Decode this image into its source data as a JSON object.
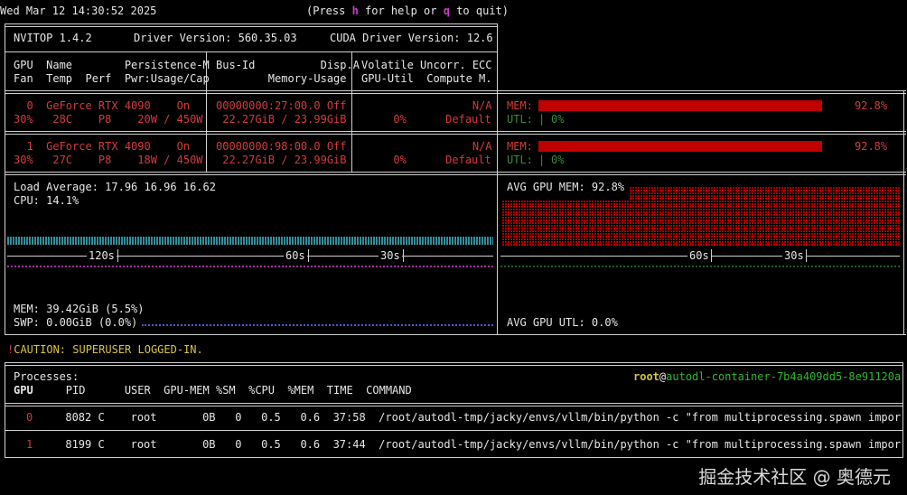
{
  "header": {
    "datetime": "Wed Mar 12 14:30:52 2025",
    "help_prefix": "(Press ",
    "help_key": "h",
    "help_mid": " for help or ",
    "quit_key": "q",
    "help_suffix": " to quit)"
  },
  "info": {
    "version": "NVITOP 1.4.2",
    "driver": "Driver Version: 560.35.03",
    "cuda": "CUDA Driver Version: 12.6"
  },
  "gpu_header": {
    "col1_line1": "GPU  Name        Persistence-M",
    "col1_line2": "Fan  Temp  Perf  Pwr:Usage/Cap",
    "col2_line1": "Bus-Id          Disp.A",
    "col2_line2": "        Memory-Usage",
    "col3_line1": "Volatile Uncorr. ECC",
    "col3_line2": "GPU-Util  Compute M."
  },
  "gpus": [
    {
      "line1_col1": "  0  GeForce RTX 4090    On",
      "line2_col1": "30%   28C    P8    20W / 450W",
      "line1_col2": "00000000:27:00.0 Off",
      "line2_col2": " 22.27GiB / 23.99GiB",
      "line1_col3": "                 N/A",
      "line2_col3": "      0%      Default",
      "mem_label": "MEM: ",
      "mem_pct": "92.8%",
      "mem_fraction": 0.928,
      "utl_label": "UTL: ",
      "utl_sep": "|",
      "utl_pct": "0%"
    },
    {
      "line1_col1": "  1  GeForce RTX 4090    On",
      "line2_col1": "30%   27C    P8    18W / 450W",
      "line1_col2": "00000000:98:00.0 Off",
      "line2_col2": " 22.27GiB / 23.99GiB",
      "line1_col3": "                 N/A",
      "line2_col3": "      0%      Default",
      "mem_label": "MEM: ",
      "mem_pct": "92.8%",
      "mem_fraction": 0.928,
      "utl_label": "UTL: ",
      "utl_sep": "|",
      "utl_pct": "0%"
    }
  ],
  "host": {
    "load_average": "Load Average: 17.96 16.96 16.62",
    "cpu": "CPU: 14.1%",
    "mem": "MEM: 39.42GiB (5.5%)",
    "swp": "SWP: 0.00GiB (0.0%)",
    "avg_gpu_mem": "AVG GPU MEM: 92.8%",
    "avg_gpu_utl": "AVG GPU UTL: 0.0%",
    "axis_left": [
      "120s",
      "60s",
      "30s"
    ],
    "axis_right": [
      "60s",
      "30s"
    ]
  },
  "caution": {
    "mark": "!",
    "text": "CAUTION: SUPERUSER LOGGED-IN."
  },
  "processes": {
    "title": "Processes:",
    "user": "root",
    "at": "@",
    "hostname": "autodl-container-7b4a409dd5-8e91120a",
    "columns": {
      "gpu": "GPU",
      "rest": "     PID      USER  GPU-MEM %SM  %CPU  %MEM  TIME  COMMAND"
    },
    "rows": [
      {
        "gpu": "0",
        "rest": "     8082 C    root       0B   0   0.5   0.6  37:58  /root/autodl-tmp/jacky/envs/vllm/bin/python -c \"from multiprocessing.spawn import ..."
      },
      {
        "gpu": "1",
        "rest": "     8199 C    root       0B   0   0.5   0.6  37:44  /root/autodl-tmp/jacky/envs/vllm/bin/python -c \"from multiprocessing.spawn import ..."
      }
    ]
  },
  "watermark": "掘金技术社区 @ 奥德元",
  "colors": {
    "gpu_row": "#d23b3b",
    "mem_bar": "#c00000",
    "utl": "#2fb82f",
    "caution": "#d7c43f",
    "hostname": "#2fb82f",
    "cpu_graph": "#3aa6b8",
    "gpu_mem_graph": "#c00000",
    "swap_graph": "#6a7de8"
  }
}
